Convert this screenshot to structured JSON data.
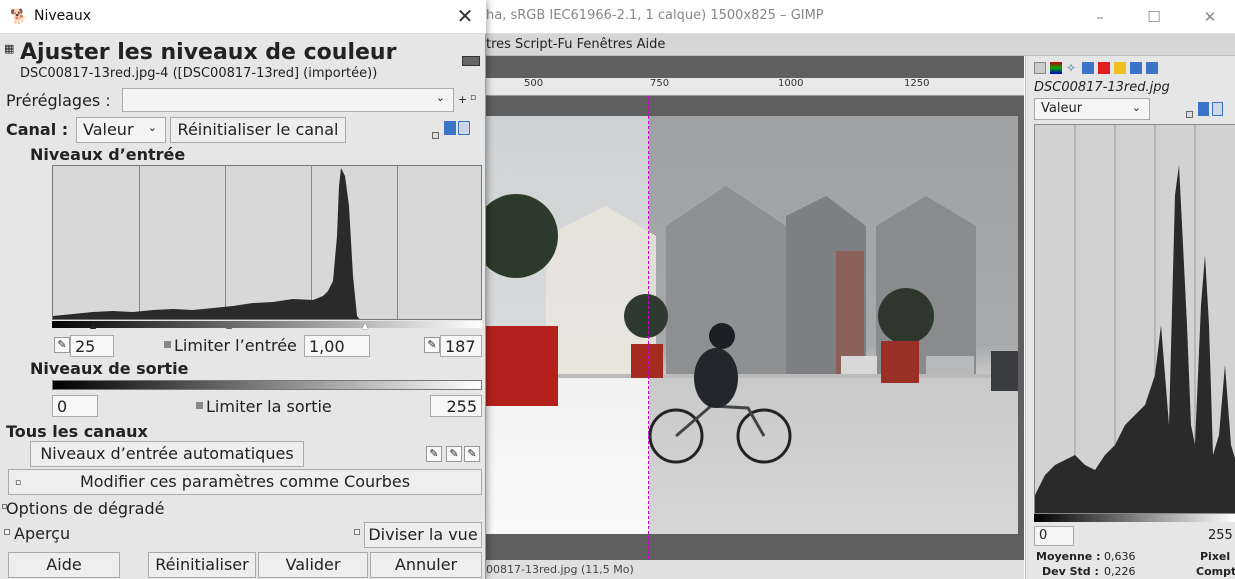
{
  "gimp": {
    "title": "ha, sRGB IEC61966-2.1, 1 calque) 1500x825 – GIMP",
    "menu": "tres Script-Fu Fenêtres Aide",
    "ruler_ticks": [
      "500",
      "750",
      "1000",
      "1250"
    ],
    "status": "00817-13red.jpg (11,5 Mo)",
    "min_label": "–",
    "max_label": "☐",
    "close_label": "✕"
  },
  "histogram_dock": {
    "image_name": "DSC00817-13red.jpg",
    "channel": "Valeur",
    "range_min": "0",
    "range_max": "255",
    "mean_label": "Moyenne :",
    "mean_value": "0,636",
    "std_label": "Dev Std :",
    "std_value": "0,226",
    "pixels_label": "Pixel",
    "count_label": "Compt"
  },
  "levels_dialog": {
    "window_title": "Niveaux",
    "close_label": "✕",
    "heading": "Ajuster les niveaux de couleur",
    "subheading": "DSC00817-13red.jpg-4 ([DSC00817-13red] (importée))",
    "presets_label": "Préréglages :",
    "channel_label": "Canal :",
    "channel_value": "Valeur",
    "reset_channel": "Réinitialiser le canal",
    "input_levels_label": "Niveaux d’entrée",
    "input_low": "25",
    "clamp_input_label": "Limiter l’entrée",
    "gamma": "1,00",
    "input_high": "187",
    "output_levels_label": "Niveaux de sortie",
    "output_low": "0",
    "clamp_output_label": "Limiter la sortie",
    "output_high": "255",
    "all_channels_label": "Tous les canaux",
    "auto_input_levels": "Niveaux d’entrée automatiques",
    "edit_as_curves": "Modifier ces paramètres comme Courbes",
    "blending_options": "Options de dégradé",
    "preview_label": "Aperçu",
    "split_view": "Diviser la vue",
    "help": "Aide",
    "reset": "Réinitialiser",
    "ok": "Valider",
    "cancel": "Annuler"
  }
}
